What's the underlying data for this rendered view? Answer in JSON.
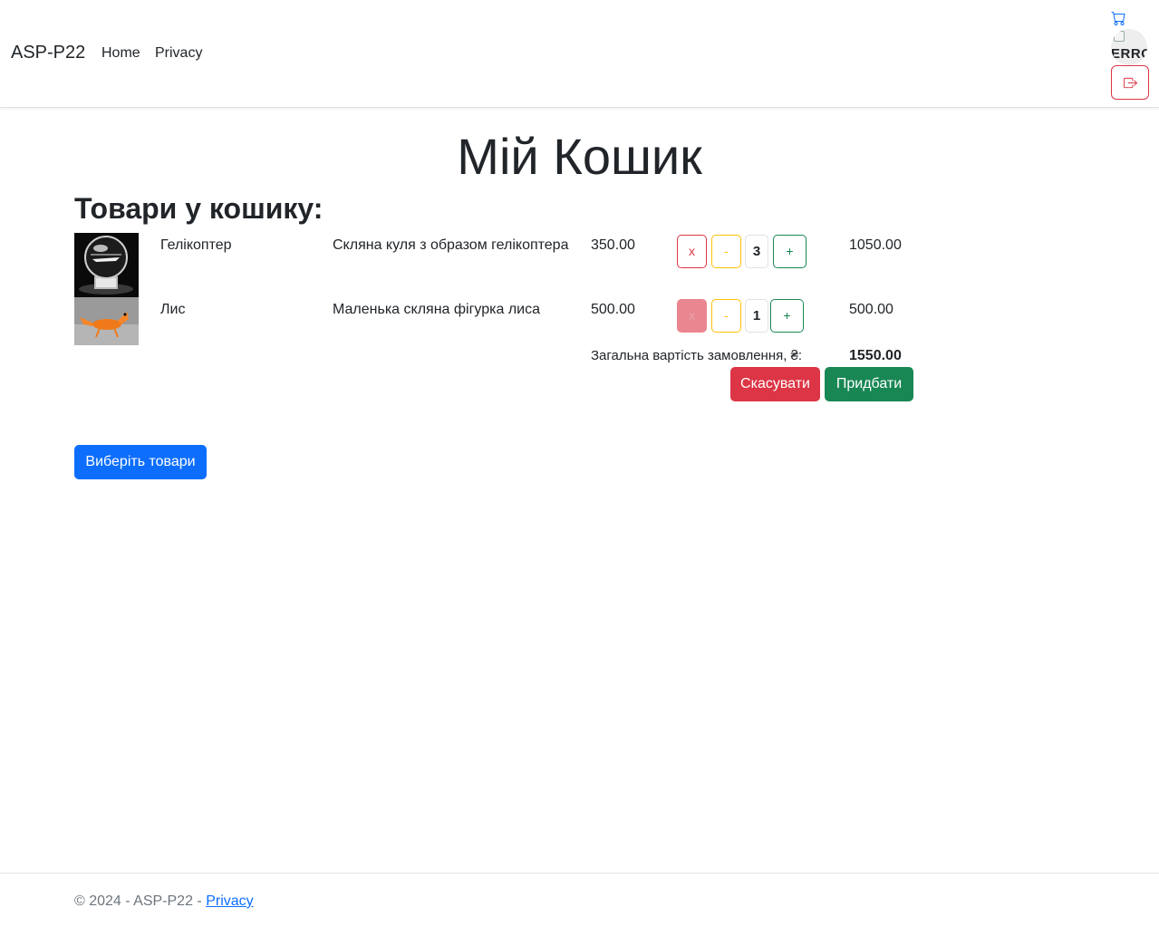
{
  "nav": {
    "brand": "ASP-P22",
    "links": [
      "Home",
      "Privacy"
    ],
    "avatar_alt": "ERROR",
    "cart_icon": "cart-icon",
    "logout_icon": "logout-icon"
  },
  "page": {
    "title": "Мій Кошик",
    "subtitle": "Товари у кошику:"
  },
  "cart": {
    "items": [
      {
        "name": "Гелікоптер",
        "description": "Скляна куля з образом гелікоптера",
        "price": "350.00",
        "quantity": "3",
        "total": "1050.00",
        "delete_label": "x",
        "minus_label": "-",
        "plus_label": "+",
        "delete_disabled": false
      },
      {
        "name": "Лис",
        "description": "Маленька скляна фігурка лиса",
        "price": "500.00",
        "quantity": "1",
        "total": "500.00",
        "delete_label": "x",
        "minus_label": "-",
        "plus_label": "+",
        "delete_disabled": true
      }
    ],
    "total_label": "Загальна вартість замовлення, ₴:",
    "total_value": "1550.00",
    "cancel_label": "Скасувати",
    "buy_label": "Придбати",
    "choose_label": "Виберіть товари"
  },
  "footer": {
    "text": "© 2024 - ASP-P22 - ",
    "link": "Privacy"
  },
  "colors": {
    "primary": "#0d6efd",
    "danger": "#dc3545",
    "success": "#198754",
    "warning": "#ffc107"
  }
}
